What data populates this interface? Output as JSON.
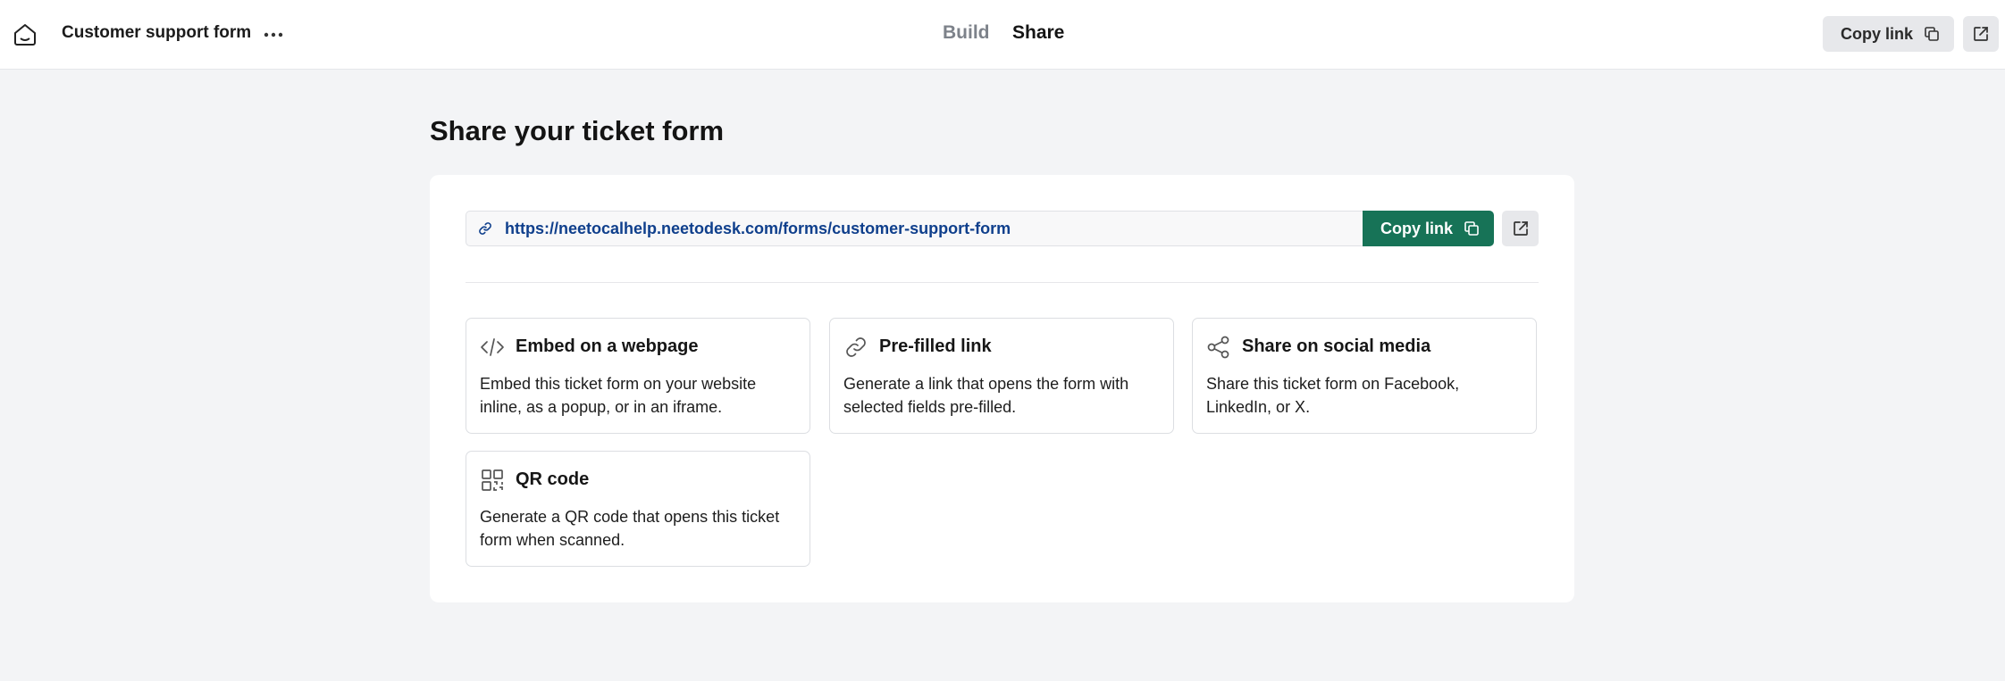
{
  "header": {
    "form_title": "Customer support form",
    "tabs": [
      {
        "label": "Build",
        "active": false
      },
      {
        "label": "Share",
        "active": true
      }
    ],
    "copy_link_label": "Copy link"
  },
  "main": {
    "heading": "Share your ticket form",
    "share_url": "https://neetocalhelp.neetodesk.com/forms/customer-support-form",
    "copy_link_label": "Copy link",
    "options": [
      {
        "icon": "code-icon",
        "title": "Embed on a webpage",
        "description": "Embed this ticket form on your website inline, as a popup, or in an iframe."
      },
      {
        "icon": "link-icon",
        "title": "Pre-filled link",
        "description": "Generate a link that opens the form with selected fields pre-filled."
      },
      {
        "icon": "share-icon",
        "title": "Share on social media",
        "description": "Share this ticket form on Facebook, LinkedIn, or X."
      },
      {
        "icon": "qr-code-icon",
        "title": "QR code",
        "description": "Generate a QR code that opens this ticket form when scanned."
      }
    ]
  },
  "colors": {
    "primary": "#177357",
    "link_text": "#0f3f8c",
    "page_background": "#f3f4f6"
  }
}
